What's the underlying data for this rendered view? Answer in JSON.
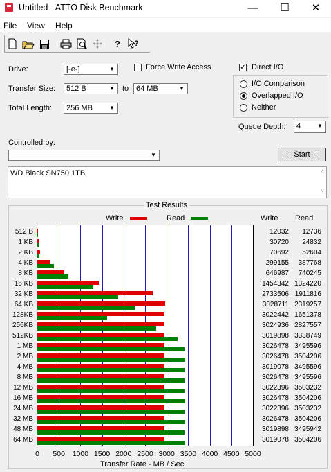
{
  "window": {
    "title": "Untitled - ATTO Disk Benchmark",
    "minimize": "—",
    "maximize": "☐",
    "close": "✕"
  },
  "menu": [
    "File",
    "View",
    "Help"
  ],
  "toolbar": [
    "new-icon",
    "open-icon",
    "save-icon",
    "print-icon",
    "print-preview-icon",
    "move-icon",
    "help-icon",
    "context-help-icon"
  ],
  "controls": {
    "drive_label": "Drive:",
    "drive_value": "[-e-]",
    "transfer_size_label": "Transfer Size:",
    "transfer_from": "512 B",
    "to_label": "to",
    "transfer_to": "64 MB",
    "total_length_label": "Total Length:",
    "total_length": "256 MB",
    "force_write_label": "Force Write Access",
    "force_write_checked": false,
    "direct_io_label": "Direct I/O",
    "direct_io_checked": true,
    "io_comparison_label": "I/O Comparison",
    "overlapped_io_label": "Overlapped I/O",
    "neither_label": "Neither",
    "selected_io_mode": "Overlapped I/O",
    "queue_depth_label": "Queue Depth:",
    "queue_depth": "4",
    "controlled_by_label": "Controlled by:",
    "controlled_by_value": "",
    "start_label": "Start",
    "description": "WD Black SN750 1TB"
  },
  "results": {
    "title": "Test Results",
    "legend_write": "Write",
    "legend_read": "Read",
    "col_write": "Write",
    "col_read": "Read",
    "write_color": "#e00000",
    "read_color": "#008000",
    "xlabel": "Transfer Rate - MB / Sec"
  },
  "chart_data": {
    "type": "bar",
    "orientation": "horizontal",
    "xlim": [
      0,
      5000
    ],
    "xticks": [
      0,
      500,
      1000,
      1500,
      2000,
      2500,
      3000,
      3500,
      4000,
      4500,
      5000
    ],
    "xlabel": "Transfer Rate - MB / Sec",
    "categories": [
      "512 B",
      "1 KB",
      "2 KB",
      "4 KB",
      "8 KB",
      "16 KB",
      "32 KB",
      "64 KB",
      "128KB",
      "256KB",
      "512KB",
      "1 MB",
      "2 MB",
      "4 MB",
      "8 MB",
      "12 MB",
      "16 MB",
      "24 MB",
      "32 MB",
      "48 MB",
      "64 MB"
    ],
    "series": [
      {
        "name": "Write",
        "values": [
          12032,
          30720,
          70692,
          299155,
          646987,
          1454342,
          2733506,
          3028711,
          3022442,
          3024936,
          3019898,
          3026478,
          3026478,
          3019078,
          3026478,
          3022396,
          3026478,
          3022396,
          3026478,
          3019898,
          3019078
        ]
      },
      {
        "name": "Read",
        "values": [
          12736,
          24832,
          52604,
          387768,
          740245,
          1324220,
          1911816,
          2319257,
          1651378,
          2827557,
          3338749,
          3495596,
          3504206,
          3495596,
          3495596,
          3503232,
          3504206,
          3503232,
          3504206,
          3495942,
          3504206
        ]
      }
    ],
    "value_unit_note": "Numeric columns are bytes/sec; bars in MB/s",
    "grid": true
  }
}
